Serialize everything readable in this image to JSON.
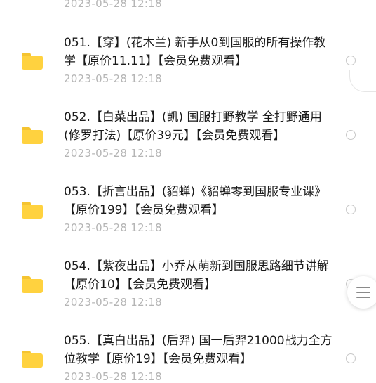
{
  "top_date": "2023-05-28  12:18",
  "items": [
    {
      "title": "051.【穿】(花木兰) 新手从0到国服的所有操作教学【原价11.11】【会员免费观看】",
      "date": "2023-05-28  12:18"
    },
    {
      "title": "052.【白菜出品】(凯) 国服打野教学 全打野通用 (修罗打法)【原价39元】【会员免费观看】",
      "date": "2023-05-28  12:18"
    },
    {
      "title": "053.【折言出品】(貂蝉)《貂蝉零到国服专业课》【原价199】【会员免费观看】",
      "date": "2023-05-28  12:18"
    },
    {
      "title": "054.【紫夜出品】小乔从萌新到国服思路细节讲解【原价10】【会员免费观看】",
      "date": "2023-05-28  12:18"
    },
    {
      "title": "055.【真白出品】(后羿) 国一后羿21000战力全方位教学【原价19】【会员免费观看】",
      "date": "2023-05-28  12:18"
    }
  ]
}
